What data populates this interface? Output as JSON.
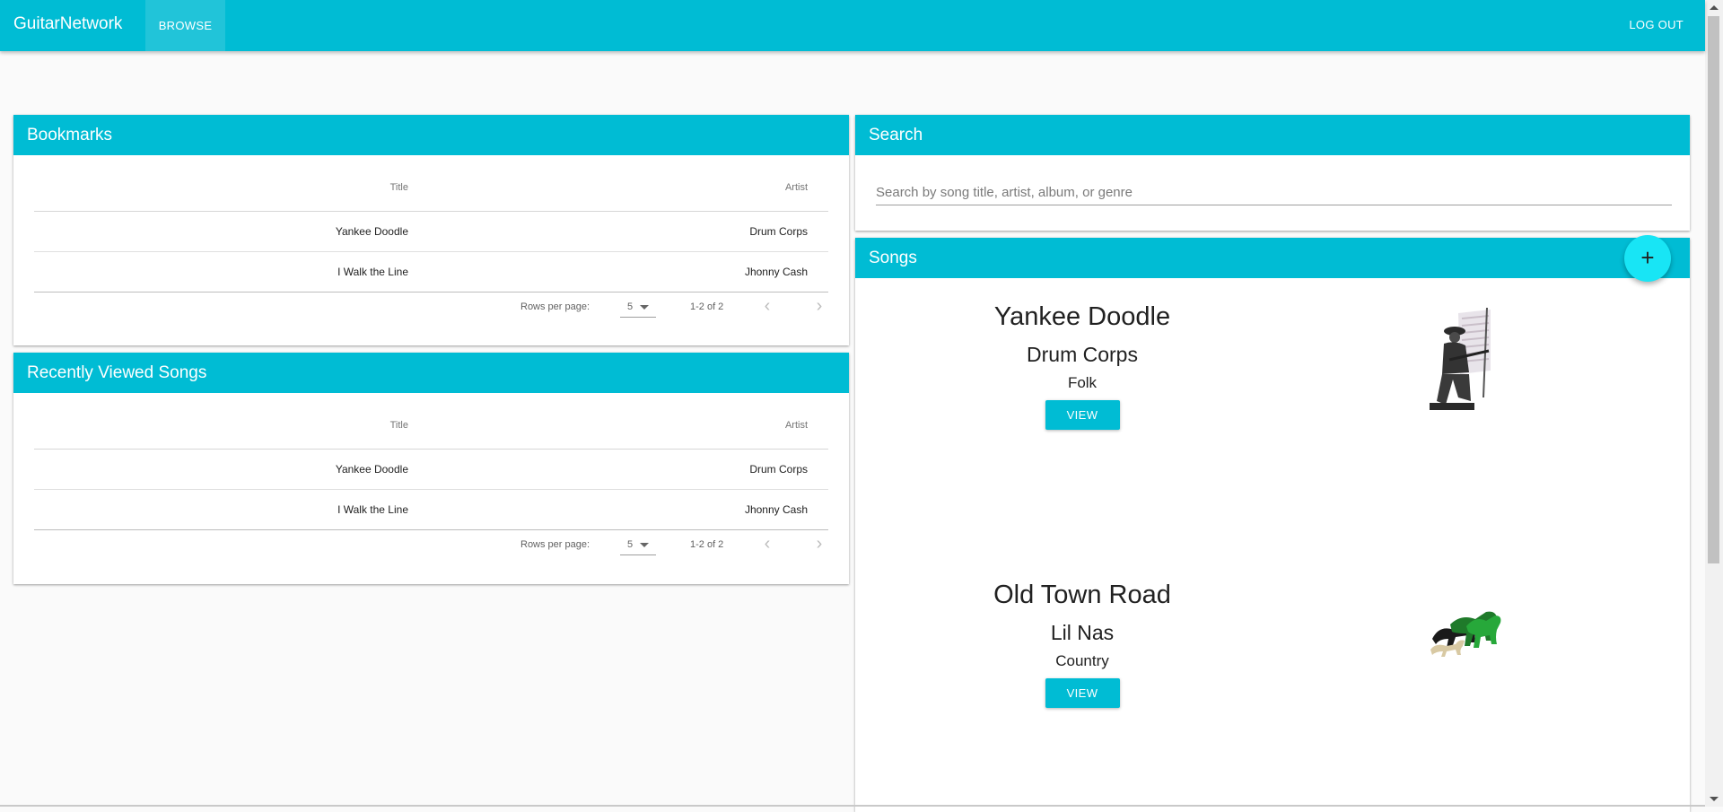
{
  "app": {
    "brand": "GuitarNetwork",
    "nav_browse": "BROWSE",
    "logout": "LOG OUT"
  },
  "bookmarks": {
    "header": "Bookmarks",
    "col_title": "Title",
    "col_artist": "Artist",
    "rows": [
      {
        "title": "Yankee Doodle",
        "artist": "Drum Corps"
      },
      {
        "title": "I Walk the Line",
        "artist": "Jhonny Cash"
      }
    ],
    "rows_per_page_label": "Rows per page:",
    "rows_per_page_value": "5",
    "range": "1-2 of 2"
  },
  "recent": {
    "header": "Recently Viewed Songs",
    "col_title": "Title",
    "col_artist": "Artist",
    "rows": [
      {
        "title": "Yankee Doodle",
        "artist": "Drum Corps"
      },
      {
        "title": "I Walk the Line",
        "artist": "Jhonny Cash"
      }
    ],
    "rows_per_page_label": "Rows per page:",
    "rows_per_page_value": "5",
    "range": "1-2 of 2"
  },
  "search": {
    "header": "Search",
    "placeholder": "Search by song title, artist, album, or genre",
    "value": ""
  },
  "songs": {
    "header": "Songs",
    "fab_icon": "plus-icon",
    "items": [
      {
        "title": "Yankee Doodle",
        "artist": "Drum Corps",
        "genre": "Folk",
        "button": "VIEW",
        "image": "minuteman-soldier-image"
      },
      {
        "title": "Old Town Road",
        "artist": "Lil Nas",
        "genre": "Country",
        "button": "VIEW",
        "image": "horses-image"
      }
    ]
  },
  "colors": {
    "primary": "#00bcd4",
    "accent": "#18e5f5",
    "background": "#fafafa"
  }
}
